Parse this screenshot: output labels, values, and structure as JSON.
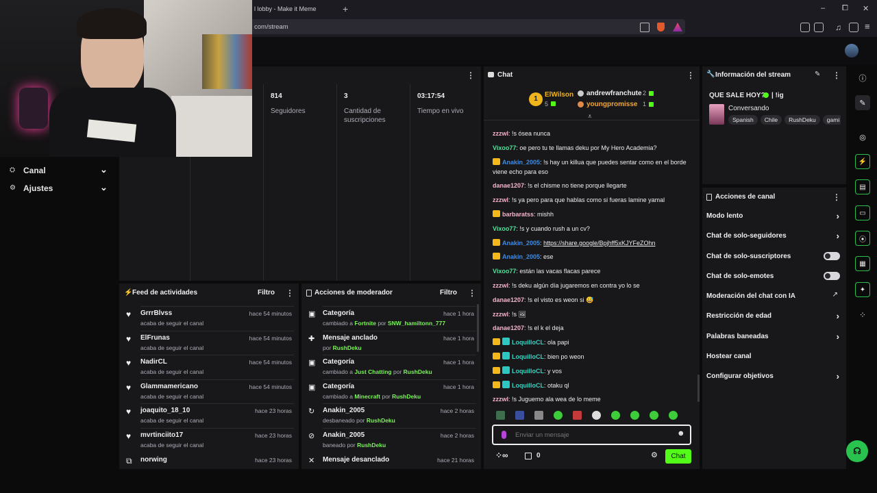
{
  "browser": {
    "tab_title": "l lobby - Make it Meme",
    "url": "com/stream",
    "win_min": "–",
    "win_max": "⧠",
    "win_close": "✕",
    "tab_add": "+"
  },
  "left_nav": {
    "canal": "Canal",
    "ajustes": "Ajustes"
  },
  "stats": [
    {
      "value": "814",
      "label": "Seguidores"
    },
    {
      "value": "3",
      "label": "Cantidad de suscripciones"
    },
    {
      "value": "03:17:54",
      "label": "Tiempo en vivo"
    }
  ],
  "feed": {
    "title": "Feed de actividades",
    "filter": "Filtro",
    "items": [
      {
        "name": "GrrrBlvss",
        "sub": "acaba de seguir el canal",
        "time": "hace 54 minutos"
      },
      {
        "name": "ElFrunas",
        "sub": "acaba de seguir el canal",
        "time": "hace 54 minutos"
      },
      {
        "name": "NadirCL",
        "sub": "acaba de seguir el canal",
        "time": "hace 54 minutos"
      },
      {
        "name": "Glammamericano",
        "sub": "acaba de seguir el canal",
        "time": "hace 54 minutos"
      },
      {
        "name": "joaquito_18_10",
        "sub": "acaba de seguir el canal",
        "time": "hace 23 horas"
      },
      {
        "name": "mvrtinciito17",
        "sub": "acaba de seguir el canal",
        "time": "hace 23 horas"
      },
      {
        "name": "norwing",
        "sub": "",
        "time": "hace 23 horas"
      }
    ]
  },
  "mod": {
    "title": "Acciones de moderador",
    "filter": "Filtro",
    "items": [
      {
        "name": "Categoría",
        "pre": "cambiado a ",
        "hl": "Fortnite",
        "mid": " por ",
        "by": "SNW_hamiltonn_777",
        "time": "hace 1 hora"
      },
      {
        "name": "Mensaje anclado",
        "pre": "por ",
        "hl": "",
        "mid": "",
        "by": "RushDeku",
        "time": "hace 1 hora"
      },
      {
        "name": "Categoría",
        "pre": "cambiado a ",
        "hl": "Just Chatting",
        "mid": " por ",
        "by": "RushDeku",
        "time": "hace 1 hora"
      },
      {
        "name": "Categoría",
        "pre": "cambiado a ",
        "hl": "Minecraft",
        "mid": " por ",
        "by": "RushDeku",
        "time": "hace 1 hora"
      },
      {
        "name": "Anakin_2005",
        "pre": "desbaneado por ",
        "hl": "",
        "mid": "",
        "by": "RushDeku",
        "time": "hace 2 horas"
      },
      {
        "name": "Anakin_2005",
        "pre": "baneado por ",
        "hl": "",
        "mid": "",
        "by": "RushDeku",
        "time": "hace 2 horas"
      },
      {
        "name": "Mensaje desanclado",
        "pre": "",
        "hl": "",
        "mid": "",
        "by": "",
        "time": "hace 21 horas"
      }
    ]
  },
  "chat": {
    "title": "Chat",
    "leader1": {
      "rank": "1",
      "name": "ElWilson",
      "count": "5"
    },
    "leader2": {
      "name": "andrewfranchute",
      "count": "2"
    },
    "leader3": {
      "name": "youngpromisse",
      "count": "1"
    },
    "messages": [
      {
        "user": "zzzwl",
        "cls": "u-pink",
        "badges": [],
        "text": ": !s ósea nunca"
      },
      {
        "user": "Vixoo77",
        "cls": "u-green",
        "badges": [],
        "text": ": oe pero tu te llamas deku por My Hero Academia?"
      },
      {
        "user": "Anakin_2005",
        "cls": "u-blue",
        "badges": [
          "crown"
        ],
        "text": ": !s hay un killua que puedes sentar como en el borde viene echo para eso"
      },
      {
        "user": "danae1207",
        "cls": "u-pink",
        "badges": [],
        "text": ": !s el chisme no tiene porque llegarte"
      },
      {
        "user": "zzzwl",
        "cls": "u-pink",
        "badges": [],
        "text": ": !s ya pero para que hablas como si fueras lamine yamal"
      },
      {
        "user": "barbaratss",
        "cls": "u-pink",
        "badges": [
          "crown"
        ],
        "text": ": mishh"
      },
      {
        "user": "Vixoo77",
        "cls": "u-green",
        "badges": [],
        "text": ": !s y cuando rush a un cv?"
      },
      {
        "user": "Anakin_2005",
        "cls": "u-blue",
        "badges": [
          "crown"
        ],
        "text": ": ",
        "link": "https://share.google/Bpjhff5xKJYFeZOhn"
      },
      {
        "user": "Anakin_2005",
        "cls": "u-blue",
        "badges": [
          "crown"
        ],
        "text": ": ese"
      },
      {
        "user": "Vixoo77",
        "cls": "u-green",
        "badges": [],
        "text": ": están las vacas flacas parece"
      },
      {
        "user": "zzzwl",
        "cls": "u-pink",
        "badges": [],
        "text": ": !s deku algún día jugaremos en contra yo lo se"
      },
      {
        "user": "danae1207",
        "cls": "u-pink",
        "badges": [],
        "text": ": !s el visto es weon si 😅"
      },
      {
        "user": "zzzwl",
        "cls": "u-pink",
        "badges": [],
        "text": ": !s 🖼"
      },
      {
        "user": "danae1207",
        "cls": "u-pink",
        "badges": [],
        "text": ": !s el k el deja"
      },
      {
        "user": "LoquilloCL",
        "cls": "u-teal",
        "badges": [
          "crown",
          "teal"
        ],
        "text": ": ola papi"
      },
      {
        "user": "LoquilloCL",
        "cls": "u-teal",
        "badges": [
          "crown",
          "teal"
        ],
        "text": ": bien po weon"
      },
      {
        "user": "LoquilloCL",
        "cls": "u-teal",
        "badges": [
          "crown",
          "teal"
        ],
        "text": ": y vos"
      },
      {
        "user": "LoquilloCL",
        "cls": "u-teal",
        "badges": [
          "crown",
          "teal"
        ],
        "text": ": otaku ql"
      },
      {
        "user": "zzzwl",
        "cls": "u-pink",
        "badges": [],
        "text": ": !s Juguemo ala wea de lo meme"
      }
    ],
    "input_placeholder": "Enviar un mensaje",
    "points": "0",
    "send": "Chat"
  },
  "stream_info": {
    "title": "Información del stream",
    "stream_title": "QUE SALE HOY?",
    "stream_title_suffix": "| !ig",
    "category": "Conversando",
    "tags": [
      "Spanish",
      "Chile",
      "RushDeku",
      "gami"
    ]
  },
  "channel_actions": {
    "title": "Acciones de canal",
    "rows": [
      {
        "label": "Modo lento",
        "type": "chevron"
      },
      {
        "label": "Chat de solo-seguidores",
        "type": "chevron"
      },
      {
        "label": "Chat de solo-suscriptores",
        "type": "toggle"
      },
      {
        "label": "Chat de solo-emotes",
        "type": "toggle"
      },
      {
        "label": "Moderación del chat con IA",
        "type": "external"
      },
      {
        "label": "Restricción de edad",
        "type": "chevron"
      },
      {
        "label": "Palabras baneadas",
        "type": "chevron"
      },
      {
        "label": "Hostear canal",
        "type": "none"
      },
      {
        "label": "Configurar objetivos",
        "type": "chevron"
      }
    ]
  },
  "colors": {
    "accent": "#53fc18",
    "panel": "#18181b",
    "bg": "#0b0b0c"
  }
}
